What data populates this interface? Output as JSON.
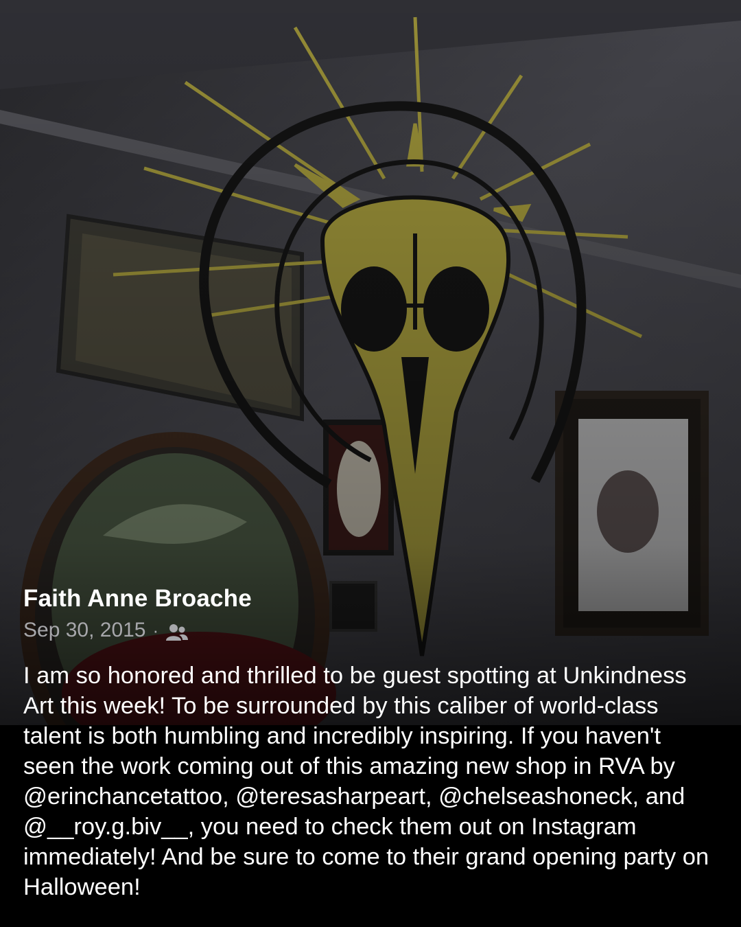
{
  "post": {
    "author": "Faith Anne Broache",
    "date": "Sep 30, 2015",
    "separator": "·",
    "audience_icon": "friends-icon",
    "text": "I am so honored and thrilled to be guest spotting at Unkindness Art this week! To be surrounded by this caliber of world-class talent is both humbling and incredibly inspiring. If you haven't seen the work coming out of this amazing new shop in RVA by @erinchancetattoo, @teresasharpeart, @chelseashoneck, and @__roy.g.biv__, you need to check them out on Instagram immediately! And be sure to come to their grand opening party on Halloween!"
  },
  "colors": {
    "photo_wall": "#4a4a4f",
    "mural_yellow": "#a59b3c",
    "mural_black": "#141414",
    "meta_gray": "#a7a7ab",
    "background": "#000000"
  }
}
